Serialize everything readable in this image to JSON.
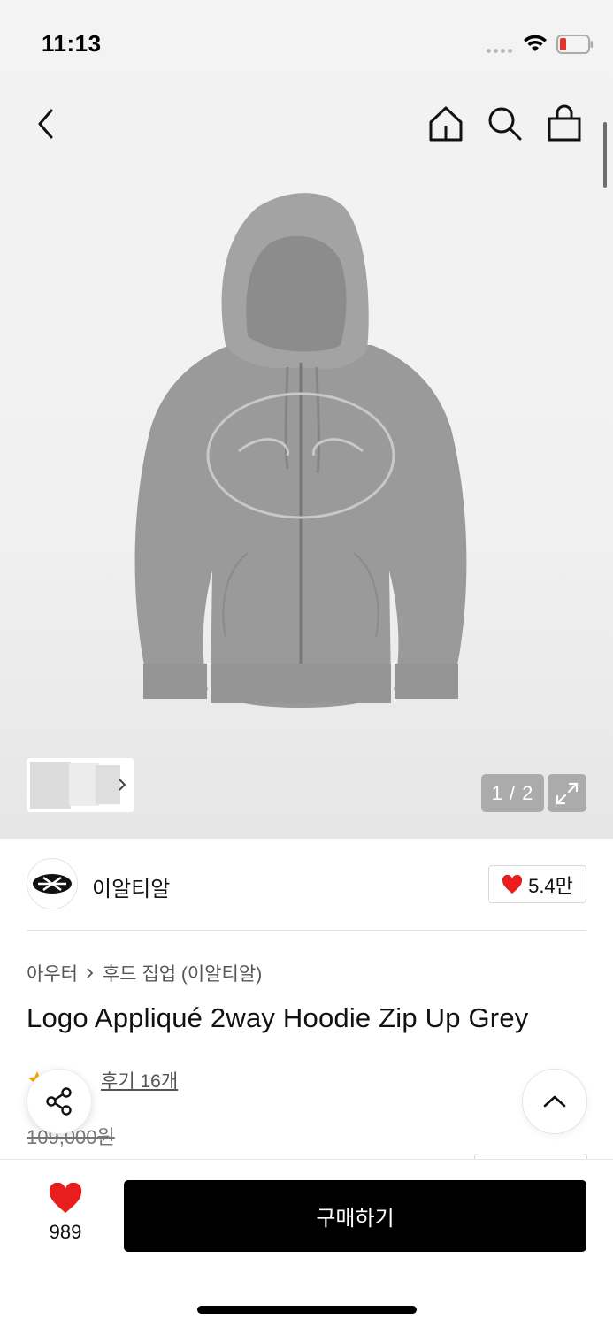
{
  "status_bar": {
    "time": "11:13",
    "icons": [
      "signal-dots-icon",
      "wifi-icon",
      "battery-low-icon"
    ],
    "battery_color": "#e5312b"
  },
  "nav": {
    "icons": [
      "back-arrow-icon",
      "home-icon",
      "search-icon",
      "shopping-bag-icon"
    ]
  },
  "gallery": {
    "counter": "1 / 2",
    "thumbnail_count_visible": 3
  },
  "brand": {
    "name": "이알티알",
    "like_count": "5.4만"
  },
  "product": {
    "breadcrumb": [
      "아우터",
      "후드 집업 (이알티알)"
    ],
    "title": "Logo Appliqué 2way Hoodie Zip Up Grey",
    "review_text": "후기 16개",
    "original_price": "109,000원"
  },
  "bottom_bar": {
    "wish_count": "989",
    "buy_label": "구매하기"
  },
  "colors": {
    "accent_red": "#e81d1d",
    "buy_button": "#000000",
    "star": "#f7a300"
  }
}
